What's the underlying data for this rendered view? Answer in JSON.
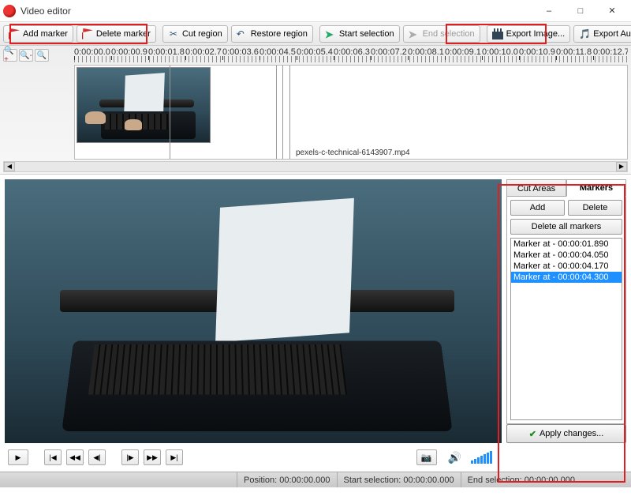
{
  "window": {
    "title": "Video editor"
  },
  "toolbar": {
    "add_marker": "Add marker",
    "delete_marker": "Delete marker",
    "cut_region": "Cut region",
    "restore_region": "Restore region",
    "start_selection": "Start selection",
    "end_selection": "End selection",
    "export_image": "Export Image...",
    "export_audio": "Export Audio..."
  },
  "timeline": {
    "ticks": [
      "0:00:00.0",
      "0:00:00.9",
      "0:00:01.8",
      "0:00:02.7",
      "0:00:03.6",
      "0:00:04.5",
      "0:00:05.4",
      "0:00:06.3",
      "0:00:07.2",
      "0:00:08.1",
      "0:00:09.1",
      "0:00:10.0",
      "0:00:10.9",
      "0:00:11.8",
      "0:00:12.7"
    ],
    "clip_filename": "pexels-c-technical-6143907.mp4"
  },
  "sidepanel": {
    "tab_cut": "Cut Areas",
    "tab_markers": "Markers",
    "add": "Add",
    "delete": "Delete",
    "delete_all": "Delete all markers",
    "markers": [
      "Marker at - 00:00:01.890",
      "Marker at - 00:00:04.050",
      "Marker at - 00:00:04.170",
      "Marker at - 00:00:04.300"
    ],
    "selected_index": 3,
    "apply": "Apply changes..."
  },
  "status": {
    "position_label": "Position:",
    "position_value": "00:00:00.000",
    "start_label": "Start selection:",
    "start_value": "00:00:00.000",
    "end_label": "End selection:",
    "end_value": "00:00:00.000"
  }
}
